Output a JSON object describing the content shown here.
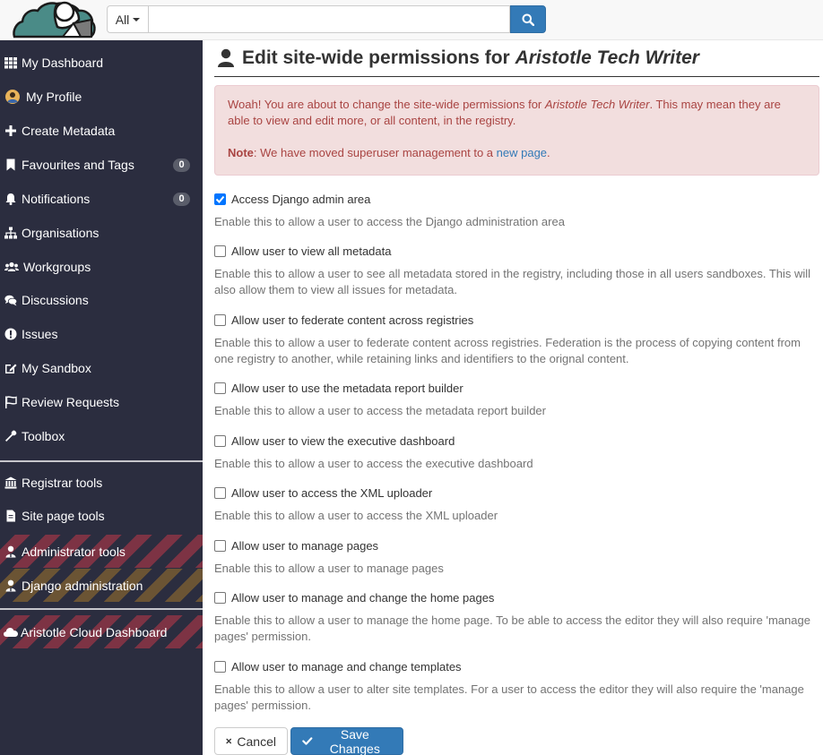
{
  "search": {
    "scope_label": "All",
    "placeholder": "",
    "value": ""
  },
  "sidebar": {
    "items": [
      {
        "label": "My Dashboard",
        "icon": "grid-icon"
      },
      {
        "label": "My Profile",
        "icon": "avatar-icon"
      },
      {
        "label": "Create Metadata",
        "icon": "plus-icon"
      },
      {
        "label": "Favourites and Tags",
        "icon": "bookmark-icon",
        "badge": "0"
      },
      {
        "label": "Notifications",
        "icon": "bell-icon",
        "badge": "0"
      },
      {
        "label": "Organisations",
        "icon": "sitemap-icon"
      },
      {
        "label": "Workgroups",
        "icon": "users-icon"
      },
      {
        "label": "Discussions",
        "icon": "comments-icon"
      },
      {
        "label": "Issues",
        "icon": "exclamation-icon"
      },
      {
        "label": "My Sandbox",
        "icon": "edit-icon"
      },
      {
        "label": "Review Requests",
        "icon": "flag-icon"
      },
      {
        "label": "Toolbox",
        "icon": "wrench-icon"
      }
    ],
    "admin_items": [
      {
        "label": "Registrar tools",
        "icon": "bank-icon"
      },
      {
        "label": "Site page tools",
        "icon": "file-icon"
      },
      {
        "label": "Administrator tools",
        "icon": "user-shield-icon"
      },
      {
        "label": "Django administration",
        "icon": "user-shield-icon"
      }
    ],
    "cloud_item": {
      "label": "Aristotle Cloud Dashboard",
      "icon": "cloud-icon"
    }
  },
  "page": {
    "title_prefix": "Edit site-wide permissions for",
    "title_user": "Aristotle Tech Writer"
  },
  "alert": {
    "line1_prefix": "Woah! You are about to change the site-wide permissions for",
    "line1_user": "Aristotle Tech Writer",
    "line1_suffix": ". This may mean they are able to view and edit more, or all content, in the registry.",
    "note_label": "Note",
    "note_text": ": We have moved superuser management to a",
    "note_link": "new page",
    "note_end": "."
  },
  "permissions": [
    {
      "label": "Access Django admin area",
      "checked": true,
      "help": "Enable this to allow a user to access the Django administration area"
    },
    {
      "label": "Allow user to view all metadata",
      "checked": false,
      "help": "Enable this to allow a user to see all metadata stored in the registry, including those in all users sandboxes. This will also allow them to view all issues for metadata."
    },
    {
      "label": "Allow user to federate content across registries",
      "checked": false,
      "help": "Enable this to allow a user to federate content across registries. Federation is the process of copying content from one registry to another, while retaining links and identifiers to the orignal content."
    },
    {
      "label": "Allow user to use the metadata report builder",
      "checked": false,
      "help": "Enable this to allow a user to access the metadata report builder"
    },
    {
      "label": "Allow user to view the executive dashboard",
      "checked": false,
      "help": "Enable this to allow a user to access the executive dashboard"
    },
    {
      "label": "Allow user to access the XML uploader",
      "checked": false,
      "help": "Enable this to allow a user to access the XML uploader"
    },
    {
      "label": "Allow user to manage pages",
      "checked": false,
      "help": "Enable this to allow a user to manage pages"
    },
    {
      "label": "Allow user to manage and change the home pages",
      "checked": false,
      "help": "Enable this to allow a user to manage the home page. To be able to access the editor they will also require 'manage pages' permission."
    },
    {
      "label": "Allow user to manage and change templates",
      "checked": false,
      "help": "Enable this to allow a user to alter site templates. For a user to access the editor they will also require the 'manage pages' permission."
    }
  ],
  "actions": {
    "cancel_label": "Cancel",
    "save_label": "Save Changes"
  },
  "colors": {
    "sidebar_bg": "#2b2d3f",
    "primary": "#337ab7",
    "alert_bg": "#f2dede",
    "alert_text": "#a94442"
  }
}
